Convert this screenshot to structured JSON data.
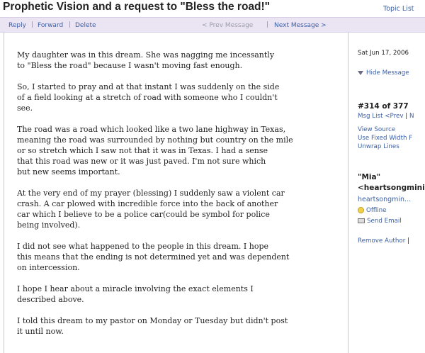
{
  "header": {
    "title": "Prophetic Vision and a request to \"Bless the road!\"",
    "topic_list": "Topic List"
  },
  "actions": {
    "reply": "Reply",
    "forward": "Forward",
    "delete": "Delete",
    "separator": "|",
    "prev_message": "< Prev Message",
    "next_message": "Next Message >"
  },
  "message": {
    "paragraphs": [
      "My daughter was in this dream. She was nagging me incessantly\nto \"Bless the road\" because I wasn't moving fast enough.",
      "So, I started to pray and at that instant I was suddenly on the side\nof a field looking at a stretch of road with someone who I couldn't\nsee.",
      "The road was a road which looked like a two lane highway in Texas,\nmeaning the road was surrounded by nothing but country on the mile\nor so stretch which I saw not that it was in Texas. I had a sense\nthat this road was new or it was just paved. I'm not sure which\nbut new seems important.",
      "At the very end of my prayer (blessing) I suddenly saw a violent car\ncrash. A car plowed with incredible force into the back of another\ncar which I believe to be a police car(could be symbol for police\nbeing involved).",
      "I did not see what happened to the people in this dream. I hope\nthis means that the ending is not determined yet and was dependent\non intercession.",
      "I hope I hear about a miracle involving the exact elements I\ndescribed above.",
      "I told this dream to my pastor on Monday or Tuesday but didn't post\nit until now."
    ]
  },
  "sidebar": {
    "date": "Sat Jun 17, 2006 ",
    "hide_message": "Hide Message",
    "msg_number": "#314 of 377",
    "msg_list": "Msg List",
    "prev": "<Prev",
    "pipe": "|",
    "next_partial": "N",
    "view_source": "View Source",
    "fixed_width": "Use Fixed Width F",
    "unwrap": "Unwrap Lines",
    "author_name": "\"Mia\"",
    "author_email": "<heartsongminis",
    "author_id": "heartsongmin...",
    "status": "Offline",
    "send_email": "Send Email",
    "remove_author": "Remove Author",
    "remove_pipe": "|"
  },
  "colors": {
    "link": "#3b5fa6",
    "action_bar_bg": "#ebe4f3",
    "text": "#222222"
  }
}
